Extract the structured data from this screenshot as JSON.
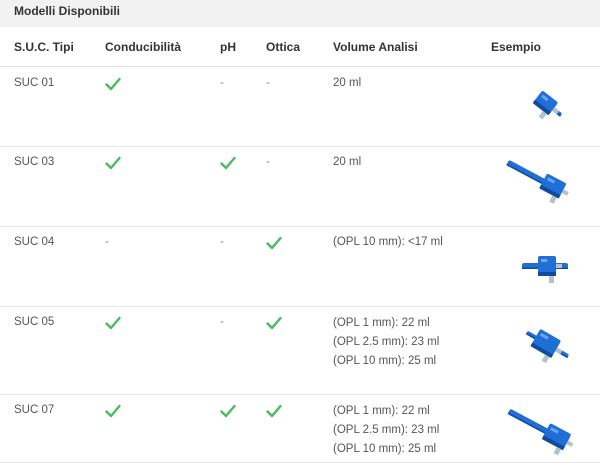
{
  "section": {
    "title": "Modelli Disponibili"
  },
  "columns": [
    "S.U.C. Tipi",
    "Conducibilità",
    "pH",
    "Ottica",
    "Volume Analisi",
    "Esempio"
  ],
  "colors": {
    "check": "#4cbb5a",
    "device_blue": "#1f6fd6",
    "device_dark": "#0f4c9c",
    "tube_metal": "#b8c0c8"
  },
  "icons": {
    "check": "check-icon",
    "example": "sensor-cell-image"
  },
  "rows": [
    {
      "tipo": "SUC 01",
      "conducibilita": "check",
      "ph": "-",
      "ottica": "-",
      "volume": [
        "20 ml"
      ]
    },
    {
      "tipo": "SUC 03",
      "conducibilita": "check",
      "ph": "check",
      "ottica": "-",
      "volume": [
        "20 ml"
      ]
    },
    {
      "tipo": "SUC 04",
      "conducibilita": "-",
      "ph": "-",
      "ottica": "check",
      "volume": [
        "(OPL 10 mm): <17 ml"
      ]
    },
    {
      "tipo": "SUC 05",
      "conducibilita": "check",
      "ph": "-",
      "ottica": "check",
      "volume": [
        "(OPL 1 mm): 22 ml",
        "(OPL 2.5 mm): 23 ml",
        "(OPL 10 mm): 25 ml"
      ]
    },
    {
      "tipo": "SUC 07",
      "conducibilita": "check",
      "ph": "check",
      "ottica": "check",
      "volume": [
        "(OPL 1 mm): 22 ml",
        "(OPL 2.5 mm): 23 ml",
        "(OPL 10 mm): 25 ml"
      ]
    }
  ]
}
